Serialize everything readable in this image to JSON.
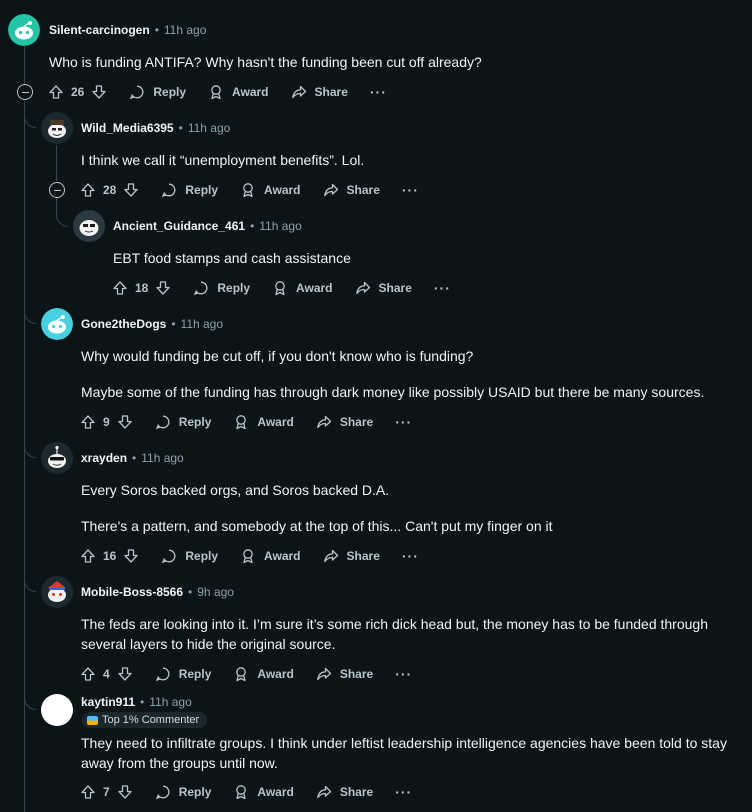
{
  "actions": {
    "reply": "Reply",
    "award": "Award",
    "share": "Share",
    "more": "···"
  },
  "comments": [
    {
      "author": "Silent-carcinogen",
      "time": "11h ago",
      "lines": [
        "Who is funding ANTIFA? Why hasn't the funding been cut off already?"
      ],
      "score": "26",
      "avatar_color": "#24c5a7"
    },
    {
      "author": "Wild_Media6395",
      "time": "11h ago",
      "lines": [
        "I think we call it “unemployment benefits”. Lol."
      ],
      "score": "28"
    },
    {
      "author": "Ancient_Guidance_461",
      "time": "11h ago",
      "lines": [
        "EBT food stamps and cash assistance"
      ],
      "score": "18"
    },
    {
      "author": "Gone2theDogs",
      "time": "11h ago",
      "lines": [
        "Why would funding be cut off, if you don't know who is funding?",
        "Maybe some of the funding has through dark money like possibly USAID but there be many sources."
      ],
      "score": "9",
      "avatar_color": "#46d0e0"
    },
    {
      "author": "xrayden",
      "time": "11h ago",
      "lines": [
        "Every Soros backed orgs, and Soros backed D.A.",
        "There's a pattern, and somebody at the top of this... Can't put my finger on it"
      ],
      "score": "16"
    },
    {
      "author": "Mobile-Boss-8566",
      "time": "9h ago",
      "lines": [
        "The feds are looking into it. I’m sure it’s some rich dick head but, the money has to be funded through",
        "several layers to hide the original source."
      ],
      "score": "4"
    },
    {
      "author": "kaytin911",
      "time": "11h ago",
      "badge": "Top 1% Commenter",
      "lines": [
        "They need to infiltrate groups. I think under leftist leadership intelligence agencies have been told to stay",
        "away from the groups until now."
      ],
      "score": "7"
    }
  ]
}
